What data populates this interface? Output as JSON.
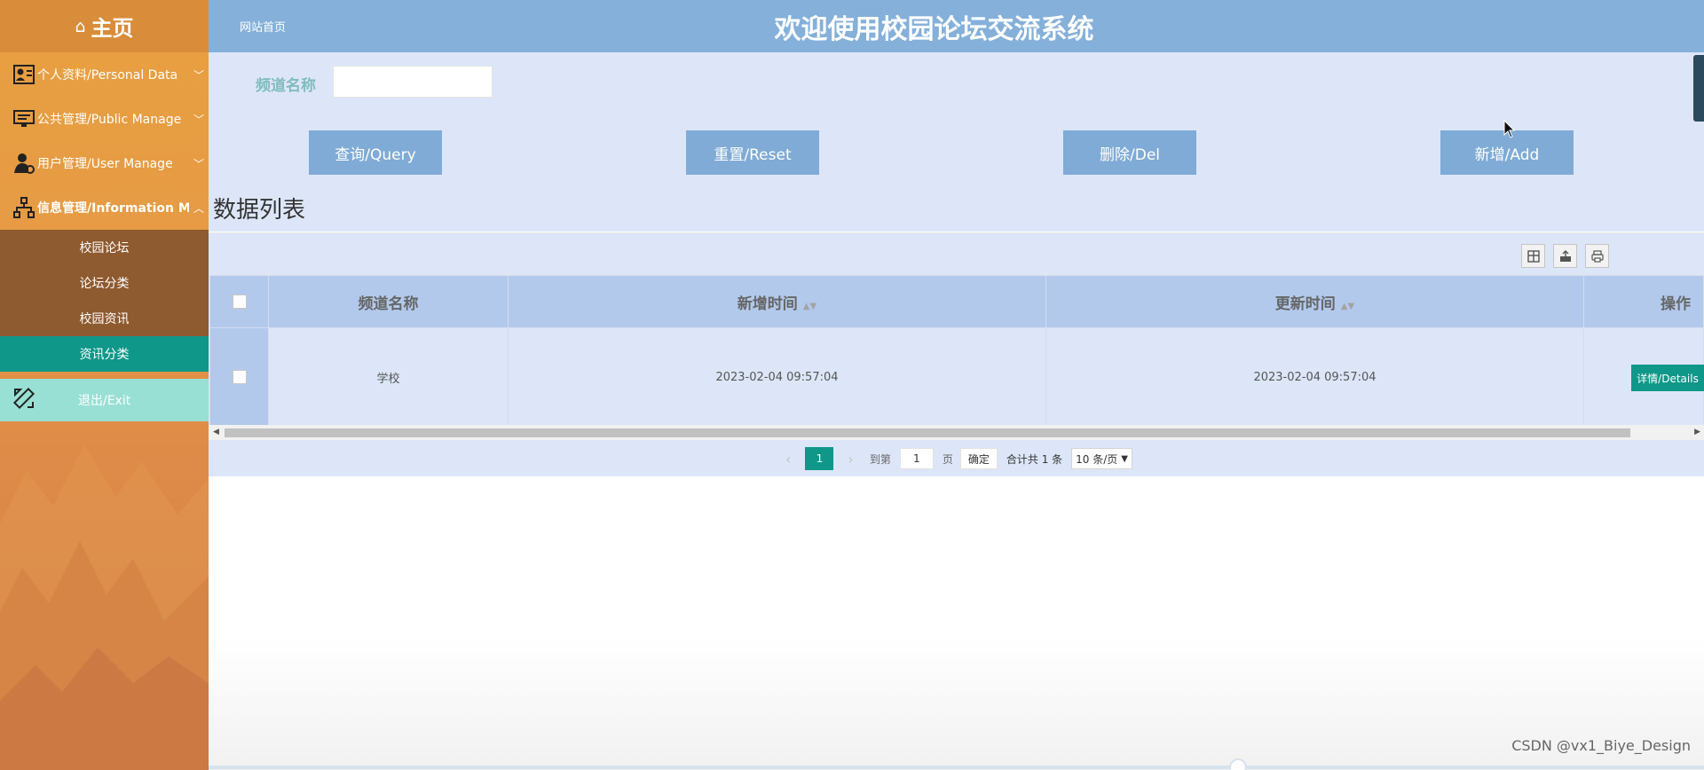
{
  "sidebar": {
    "home_label": "主页",
    "menus": [
      {
        "label": "个人资料/Personal Data",
        "icon": "user-card-icon"
      },
      {
        "label": "公共管理/Public Manage",
        "icon": "monitor-icon"
      },
      {
        "label": "用户管理/User Manage",
        "icon": "user-gear-icon"
      },
      {
        "label": "信息管理/Information Manage",
        "icon": "sitemap-icon"
      }
    ],
    "sub_items": [
      "校园论坛",
      "论坛分类",
      "校园资讯",
      "资讯分类"
    ],
    "active_sub": "资讯分类",
    "exit_label": "退出/Exit"
  },
  "header": {
    "breadcrumb": "网站首页",
    "title": "欢迎使用校园论坛交流系统"
  },
  "filter": {
    "channel_label": "频道名称",
    "channel_value": ""
  },
  "buttons": {
    "query": "查询/Query",
    "reset": "重置/Reset",
    "delete": "删除/Del",
    "add": "新增/Add"
  },
  "list_title": "数据列表",
  "table": {
    "columns": [
      "频道名称",
      "新增时间",
      "更新时间",
      "操作"
    ],
    "rows": [
      {
        "channel": "学校",
        "created": "2023-02-04 09:57:04",
        "updated": "2023-02-04 09:57:04",
        "action": "详情/Details"
      }
    ]
  },
  "pager": {
    "current_page": "1",
    "goto_label": "到第",
    "goto_value": "1",
    "page_unit": "页",
    "confirm": "确定",
    "total": "合计共 1 条",
    "page_size": "10 条/页"
  },
  "watermark": "CSDN @vx1_Biye_Design",
  "colors": {
    "header_bg": "#84b0da",
    "button_bg": "#7fabd6",
    "active_teal": "#0f9789",
    "content_bg": "#dde6f8"
  }
}
